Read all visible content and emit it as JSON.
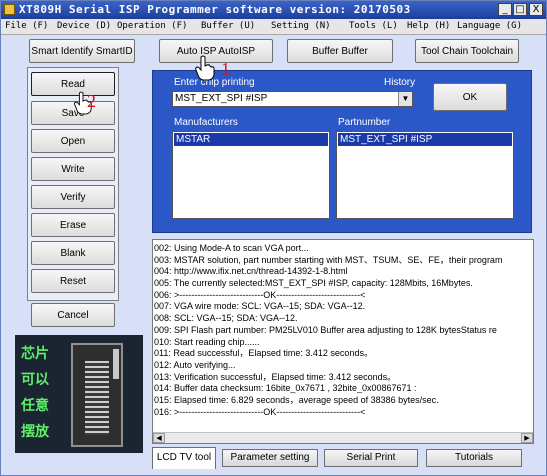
{
  "window": {
    "title": "XT809H Serial ISP Programmer software version: 20170503",
    "controls": [
      "_",
      "□",
      "X"
    ]
  },
  "menu": [
    "File (F)",
    "Device (D)",
    "Operation (F)",
    "Buffer (U)",
    "Setting (N)",
    "Tools (L)",
    "Help (H)",
    "Language (G)"
  ],
  "toolbar": {
    "smart_identify": "Smart Identify SmartID",
    "auto_isp": "Auto ISP AutoISP",
    "buffer": "Buffer Buffer",
    "toolchain": "Tool Chain Toolchain"
  },
  "ops": {
    "read": "Read",
    "save": "Save",
    "open": "Open",
    "write": "Write",
    "verify": "Verify",
    "erase": "Erase",
    "blank": "Blank",
    "reset": "Reset",
    "cancel": "Cancel"
  },
  "chip_printing": {
    "label": "Enter chip printing",
    "history_label": "History",
    "value": "MST_EXT_SPI #ISP",
    "ok": "OK"
  },
  "manufacturers": {
    "label": "Manufacturers",
    "selected": "MSTAR"
  },
  "partnumber": {
    "label": "Partnumber",
    "selected": "MST_EXT_SPI #ISP"
  },
  "socket_caption": [
    "芯片",
    "可以",
    "任意",
    "摆放"
  ],
  "annotations": [
    "1",
    "2"
  ],
  "log": [
    "002:  Using Mode-A to scan VGA port...",
    "003:  MSTAR solution, part number starting with MST、TSUM、SE、FE，their program",
    "004:  http://www.ifix.net.cn/thread-14392-1-8.html",
    "005:  The currently selected:MST_EXT_SPI #ISP, capacity: 128Mbits, 16Mbytes.",
    "006:  >----------------------------OK----------------------------<",
    "007:  VGA wire mode: SCL: VGA--15; SDA: VGA--12.",
    "008:  SCL: VGA--15; SDA: VGA--12.",
    "009:  SPI Flash part number:  PM25LV010 Buffer area adjusting to 128K bytesStatus re",
    "010:  Start reading chip......",
    "011:  Read successful，Elapsed time:  3.412 seconds。",
    "012:  Auto verifying...",
    "013:  Verification successful，Elapsed time:  3.412 seconds。",
    "014:  Buffer data checksum:  16bite_0x7671 ,  32bite_0x00867671 :",
    "015:  Elapsed time: 6.829 seconds，average speed of 38386 bytes/sec.",
    "016:  >----------------------------OK----------------------------<"
  ],
  "tabs": [
    "LCD TV tool",
    "Parameter setting",
    "Serial Print",
    "Tutorials"
  ],
  "colors": {
    "titlebar": "#1c3e9c",
    "panel_blue": "#2b57c7",
    "selection": "#1a3aa8",
    "annotation_red": "#dd1111",
    "chip_text_green": "#5ff06a"
  }
}
